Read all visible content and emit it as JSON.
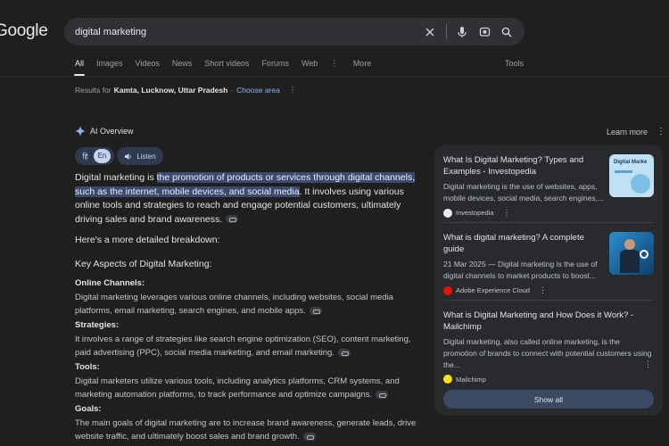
{
  "logo": "Google",
  "search": {
    "query": "digital marketing"
  },
  "tabs": [
    "All",
    "Images",
    "Videos",
    "News",
    "Short videos",
    "Forums",
    "Web",
    "More"
  ],
  "tools_label": "Tools",
  "results_for": {
    "prefix": "Results for",
    "location": "Kamta, Lucknow, Uttar Pradesh",
    "separator": "·",
    "choose_area": "Choose area"
  },
  "ai_overview": {
    "title": "AI Overview",
    "learn_more": "Learn more",
    "lang_alt": "हि",
    "lang_active": "En",
    "listen": "Listen",
    "intro_prefix": "Digital marketing is ",
    "intro_highlight": "the promotion of products or services through digital channels, such as the internet, mobile devices, and social media",
    "intro_suffix": ". It involves using various online tools and strategies to reach and engage potential customers, ultimately driving sales and brand awareness.",
    "breakdown": "Here's a more detailed breakdown:",
    "key_aspects": "Key Aspects of Digital Marketing:",
    "sections": [
      {
        "heading": "Online Channels:",
        "body": "Digital marketing leverages various online channels, including websites, social media platforms, email marketing, search engines, and mobile apps."
      },
      {
        "heading": "Strategies:",
        "body": "It involves a range of strategies like search engine optimization (SEO), content marketing, paid advertising (PPC), social media marketing, and email marketing."
      },
      {
        "heading": "Tools:",
        "body": "Digital marketers utilize various tools, including analytics platforms, CRM systems, and marketing automation platforms, to track performance and optimize campaigns."
      },
      {
        "heading": "Goals:",
        "body": "The main goals of digital marketing are to increase brand awareness, generate leads, drive website traffic, and ultimately boost sales and brand growth."
      }
    ]
  },
  "sources": [
    {
      "title": "What Is Digital Marketing? Types and Examples - Investopedia",
      "snippet": "Digital marketing is the use of websites, apps, mobile devices, social media, search engines,...",
      "site": "Investopedia",
      "thumb_text": "Digital Marke"
    },
    {
      "title": "What is digital marketing? A complete guide",
      "snippet": "21 Mar 2025 — Digital marketing is the use of digital channels to market products to boost...",
      "site": "Adobe Experience Cloud"
    },
    {
      "title": "What is Digital Marketing and How Does it Work? - Mailchimp",
      "snippet": "Digital marketing, also called online marketing, is the promotion of brands to connect with potential customers using the...",
      "site": "Mailchimp"
    }
  ],
  "show_all": "Show all",
  "colors": {
    "background": "#1f1f1f",
    "accent_link": "#8ab4f8",
    "highlight": "#3c4a6e",
    "panel": "#282a2d"
  }
}
